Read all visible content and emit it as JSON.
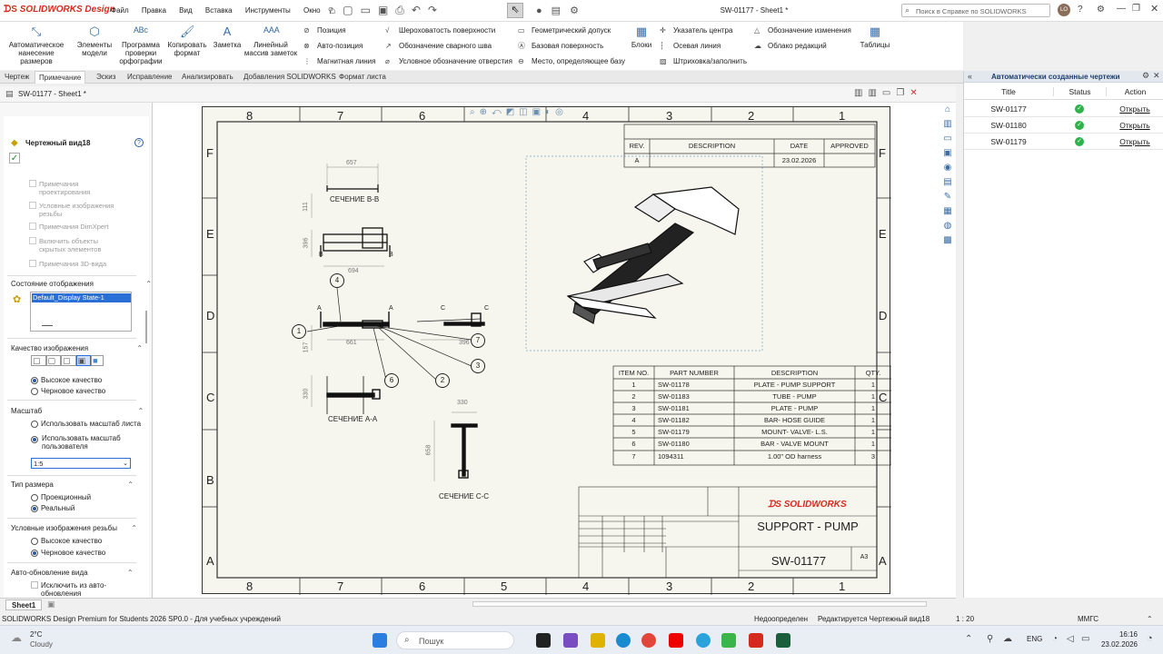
{
  "app": {
    "logo": "SOLIDWORKS Design",
    "menu": [
      "Файл",
      "Правка",
      "Вид",
      "Вставка",
      "Инструменты",
      "Окно"
    ],
    "doc_title": "SW-01177 - Sheet1 *",
    "search_placeholder": "Поиск в Справке по SOLIDWORKS",
    "user_initials": "LO"
  },
  "ribbon": {
    "big_buttons": [
      {
        "label": "Автоматическое нанесение размеров",
        "icon": "auto-dimension-icon"
      },
      {
        "label": "Элементы модели",
        "icon": "model-items-icon"
      },
      {
        "label": "Программа проверки орфографии",
        "icon": "spell-check-icon"
      },
      {
        "label": "Копировать формат",
        "icon": "format-painter-icon"
      },
      {
        "label": "Заметка",
        "icon": "note-icon"
      },
      {
        "label": "Линейный массив заметок",
        "icon": "linear-note-pattern-icon"
      }
    ],
    "col1": [
      "Позиция",
      "Авто-позиция",
      "Магнитная линия"
    ],
    "col2": [
      "Шероховатость поверхности",
      "Обозначение сварного шва",
      "Условное обозначение отверстия"
    ],
    "col3": [
      "Геометрический допуск",
      "Базовая поверхность",
      "Место, определяющее базу"
    ],
    "blocks_label": "Блоки",
    "col4": [
      "Указатель центра",
      "Осевая линия",
      "Штриховка/заполнить"
    ],
    "col5": [
      "Обозначение изменения",
      "Облако редакций"
    ],
    "tables_label": "Таблицы"
  },
  "tabs": [
    "Чертеж",
    "Примечание",
    "Эскиз",
    "Исправление",
    "Анализировать",
    "Добавления SOLIDWORKS",
    "Формат листа"
  ],
  "active_tab": "Примечание",
  "document_tab": "SW-01177 - Sheet1 *",
  "property_manager": {
    "title": "Чертежный вид18",
    "disabled_options": [
      "Примечания проектирования",
      "Условные изображения резьбы",
      "Примечания DimXpert",
      "Включить объекты скрытых элементов",
      "Примечания 3D-вида"
    ],
    "display_state_header": "Состояние отображения",
    "display_state_value": "Default_Display State-1",
    "image_quality_header": "Качество изображения",
    "quality_options": [
      "Высокое качество",
      "Черновое качество"
    ],
    "scale_header": "Масштаб",
    "scale_options": [
      "Использовать масштаб листа",
      "Использовать масштаб пользователя"
    ],
    "scale_value": "1:5",
    "dim_type_header": "Тип размера",
    "dim_type_options": [
      "Проекционный",
      "Реальный"
    ],
    "thread_header": "Условные изображения резьбы",
    "thread_options": [
      "Высокое качество",
      "Черновое качество"
    ],
    "auto_update_header": "Авто-обновление вида",
    "auto_update_option": "Исключить из авто-обновления"
  },
  "sheet_tab": "Sheet1",
  "drawing": {
    "columns": [
      "8",
      "7",
      "6",
      "5",
      "4",
      "3",
      "2",
      "1"
    ],
    "rows": [
      "F",
      "E",
      "D",
      "C",
      "B",
      "A"
    ],
    "rev_table": {
      "headers": [
        "REV.",
        "DESCRIPTION",
        "DATE",
        "APPROVED"
      ],
      "row": [
        "A",
        "",
        "23.02.2026",
        ""
      ]
    },
    "views": {
      "section_bb": "СЕЧЕНИЕ B-B",
      "section_aa": "СЕЧЕНИЕ A-A",
      "section_cc": "СЕЧЕНИЕ C-C"
    },
    "dims": {
      "d657": "657",
      "d111": "111",
      "d396a": "396",
      "d694": "694",
      "d157": "157",
      "d661": "661",
      "d396b": "396",
      "d330a": "330",
      "d330b": "330",
      "d658": "658"
    },
    "balloons": [
      "4",
      "1",
      "7",
      "3",
      "6",
      "2"
    ],
    "bom": {
      "headers": [
        "ITEM NO.",
        "PART NUMBER",
        "DESCRIPTION",
        "QTY."
      ],
      "rows": [
        [
          "1",
          "SW-01178",
          "PLATE - PUMP SUPPORT",
          "1"
        ],
        [
          "2",
          "SW-01183",
          "TUBE - PUMP",
          "1"
        ],
        [
          "3",
          "SW-01181",
          "PLATE - PUMP",
          "1"
        ],
        [
          "4",
          "SW-01182",
          "BAR- HOSE GUIDE",
          "1"
        ],
        [
          "5",
          "SW-01179",
          "MOUNT- VALVE- L.S.",
          "1"
        ],
        [
          "6",
          "SW-01180",
          "BAR - VALVE MOUNT",
          "1"
        ],
        [
          "7",
          "1094311",
          "1.00\" OD harness",
          "3"
        ]
      ]
    },
    "title_block": {
      "brand": "SOLIDWORKS",
      "title": "SUPPORT - PUMP",
      "dwg_no": "SW-01177",
      "size": "A3"
    }
  },
  "task_panel": {
    "title": "Автоматически созданные чертежи",
    "headers": [
      "Title",
      "Status",
      "Action"
    ],
    "rows": [
      {
        "title": "SW-01177",
        "action": "Открыть"
      },
      {
        "title": "SW-01180",
        "action": "Открыть"
      },
      {
        "title": "SW-01179",
        "action": "Открыть"
      }
    ],
    "status_color": "#2fb24a"
  },
  "status_bar": {
    "left": "SOLIDWORKS Design Premium for Students 2026 SP0.0 - Для учебных учреждений",
    "state": "Недоопределен",
    "editing": "Редактируется Чертежный вид18",
    "scale": "1 : 20",
    "units": "ММГС"
  },
  "taskbar": {
    "weather_temp": "2°C",
    "weather_desc": "Cloudy",
    "search_label": "Пошук",
    "lang": "ENG",
    "time": "16:16",
    "date": "23.02.2026"
  },
  "colors": {
    "accent": "#2a5aa0",
    "brand_red": "#d52b1e",
    "sheet_bg": "#f7f6ee",
    "panel_header": "#e3e8ef"
  }
}
